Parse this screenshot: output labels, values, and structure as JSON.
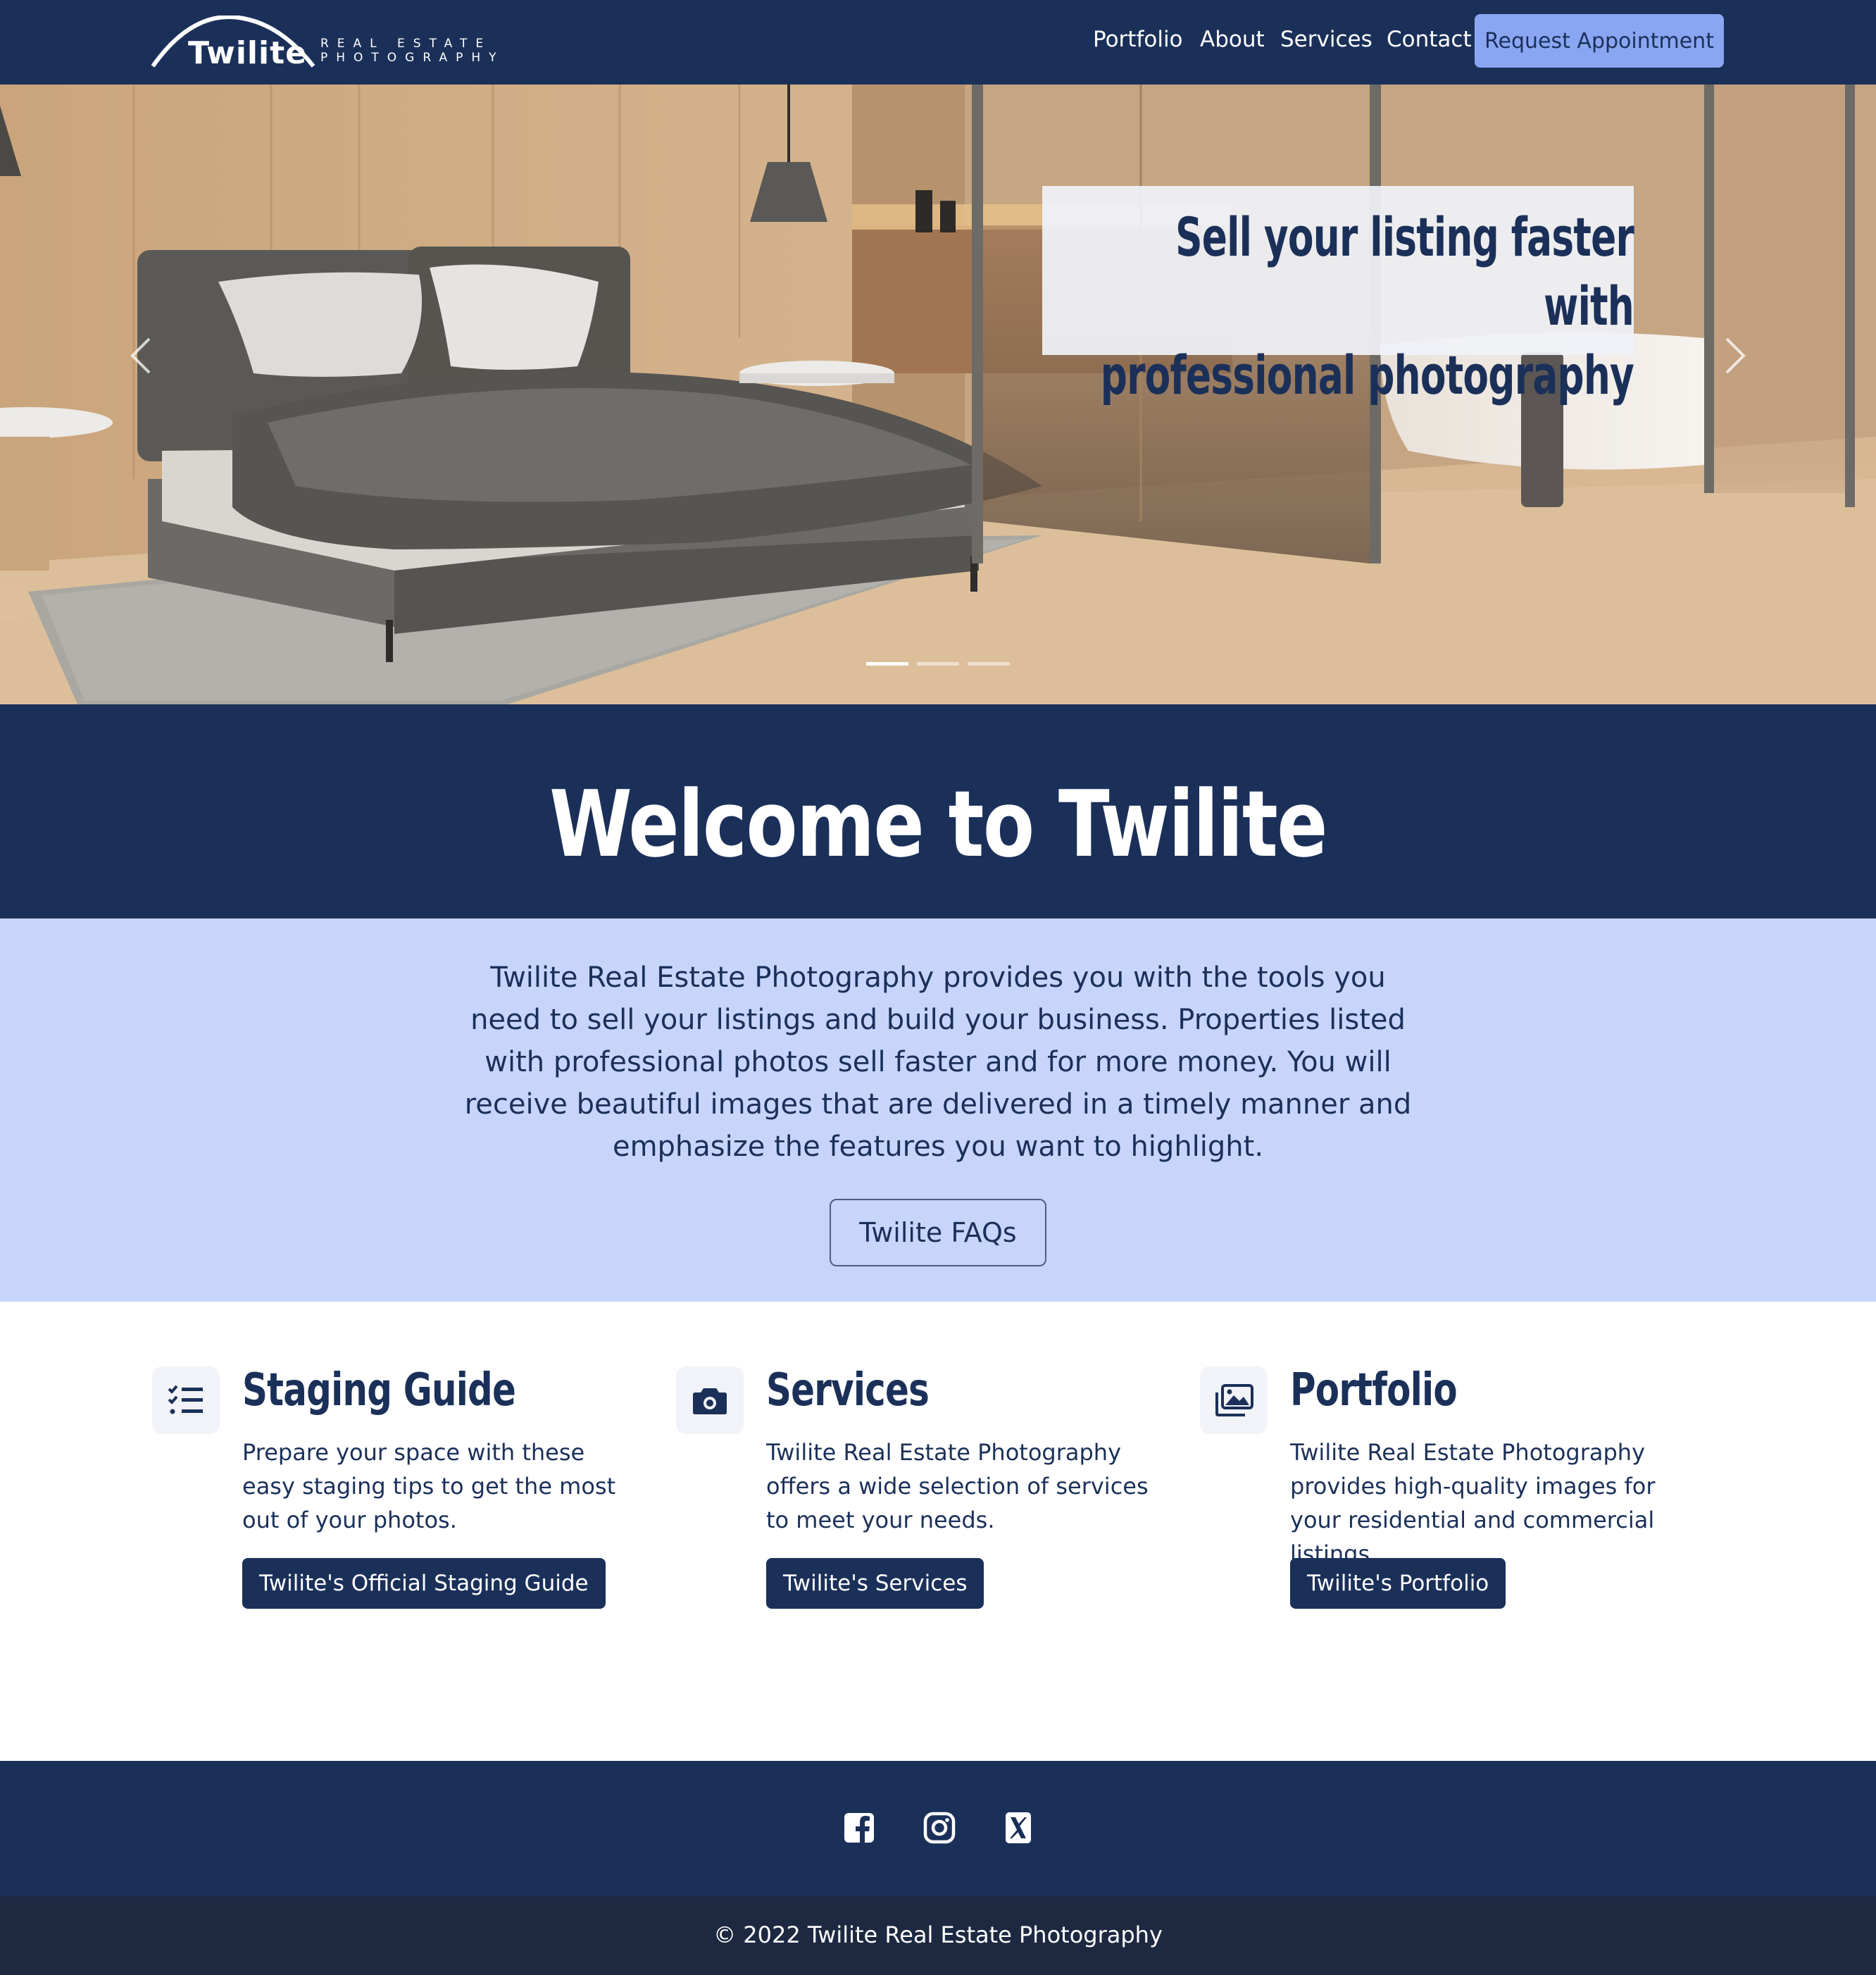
{
  "brand": {
    "name": "Twilite",
    "tagline_line1": "REAL ESTATE",
    "tagline_line2": "PHOTOGRAPHY"
  },
  "nav": {
    "links": [
      "Portfolio",
      "About",
      "Services",
      "Contact"
    ],
    "cta": "Request Appointment"
  },
  "hero": {
    "caption_line1": "Sell your listing faster with",
    "caption_line2": "professional photography",
    "prev_icon": "chevron-left-icon",
    "next_icon": "chevron-right-icon",
    "slide_count": 3,
    "active_slide": 1
  },
  "welcome": {
    "title": "Welcome to Twilite"
  },
  "intro": {
    "text": "Twilite Real Estate Photography provides you with the tools you need to sell your listings and build your business. Properties listed with professional photos sell faster and for more money. You will receive beautiful images that are delivered in a timely manner and emphasize the features you want to highlight.",
    "button": "Twilite FAQs"
  },
  "features": [
    {
      "icon": "checklist-icon",
      "title": "Staging Guide",
      "description": "Prepare your space with these easy staging tips to get the most out of your photos.",
      "button": "Twilite's Official Staging Guide"
    },
    {
      "icon": "camera-icon",
      "title": "Services",
      "description": "Twilite Real Estate Photography offers a wide selection of services to meet your needs.",
      "button": "Twilite's Services"
    },
    {
      "icon": "images-icon",
      "title": "Portfolio",
      "description": "Twilite Real Estate Photography provides high-quality images for your residential and commercial listings.",
      "button": "Twilite's Portfolio"
    }
  ],
  "footer": {
    "social": [
      "facebook-icon",
      "instagram-icon",
      "x-twitter-icon"
    ],
    "copyright": "© 2022 Twilite Real Estate Photography"
  },
  "colors": {
    "navy": "#1b3059",
    "light_blue": "#c7d5fb",
    "accent_button": "#8aa6f2",
    "footer_dark": "#1d2841"
  }
}
